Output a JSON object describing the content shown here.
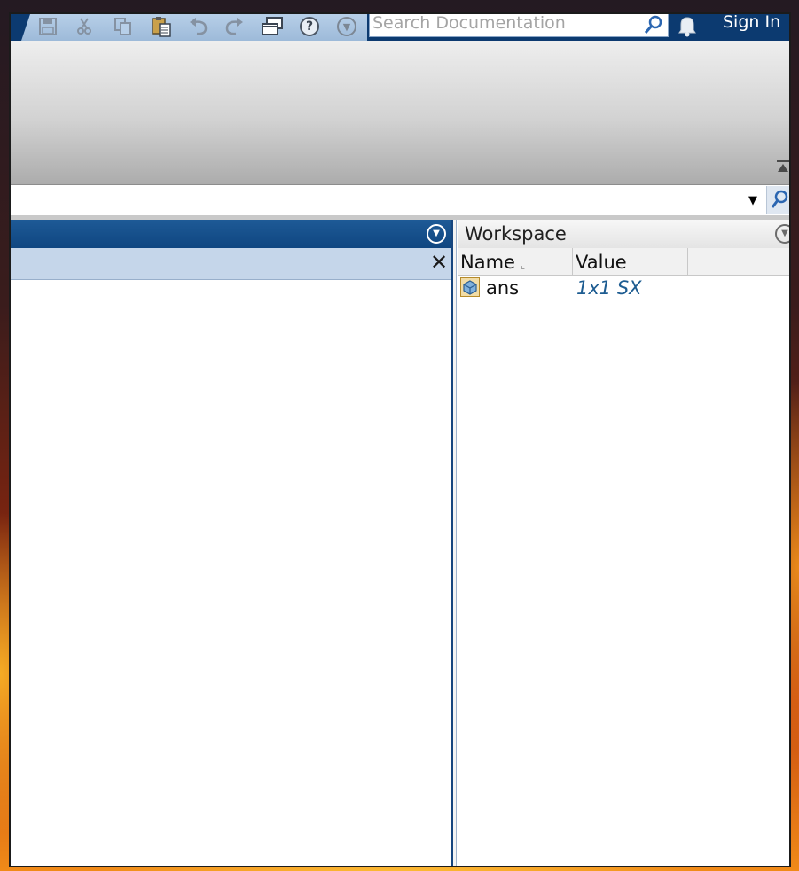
{
  "toolbar": {
    "buttons": [
      {
        "name": "save",
        "icon": "save-icon"
      },
      {
        "name": "cut",
        "icon": "cut-icon"
      },
      {
        "name": "copy",
        "icon": "copy-icon"
      },
      {
        "name": "paste",
        "icon": "paste-icon"
      },
      {
        "name": "undo",
        "icon": "undo-icon"
      },
      {
        "name": "redo",
        "icon": "redo-icon"
      },
      {
        "name": "switch-windows",
        "icon": "switch-windows-icon"
      },
      {
        "name": "help",
        "icon": "help-icon"
      },
      {
        "name": "customize",
        "icon": "chevron-down-icon"
      }
    ]
  },
  "search": {
    "placeholder": "Search Documentation"
  },
  "header": {
    "sign_in": "Sign In"
  },
  "address_bar": {
    "value": ""
  },
  "left_panel": {
    "title": ""
  },
  "workspace": {
    "title": "Workspace",
    "columns": [
      "Name",
      "Value",
      ""
    ],
    "rows": [
      {
        "name": "ans",
        "value": "1x1 SX",
        "icon": "variable-icon"
      }
    ]
  },
  "colors": {
    "title_bar": "#0c3a70",
    "panel_header": "#0f4681",
    "subheader": "#c5d6ea",
    "value_text": "#1d5c91"
  }
}
